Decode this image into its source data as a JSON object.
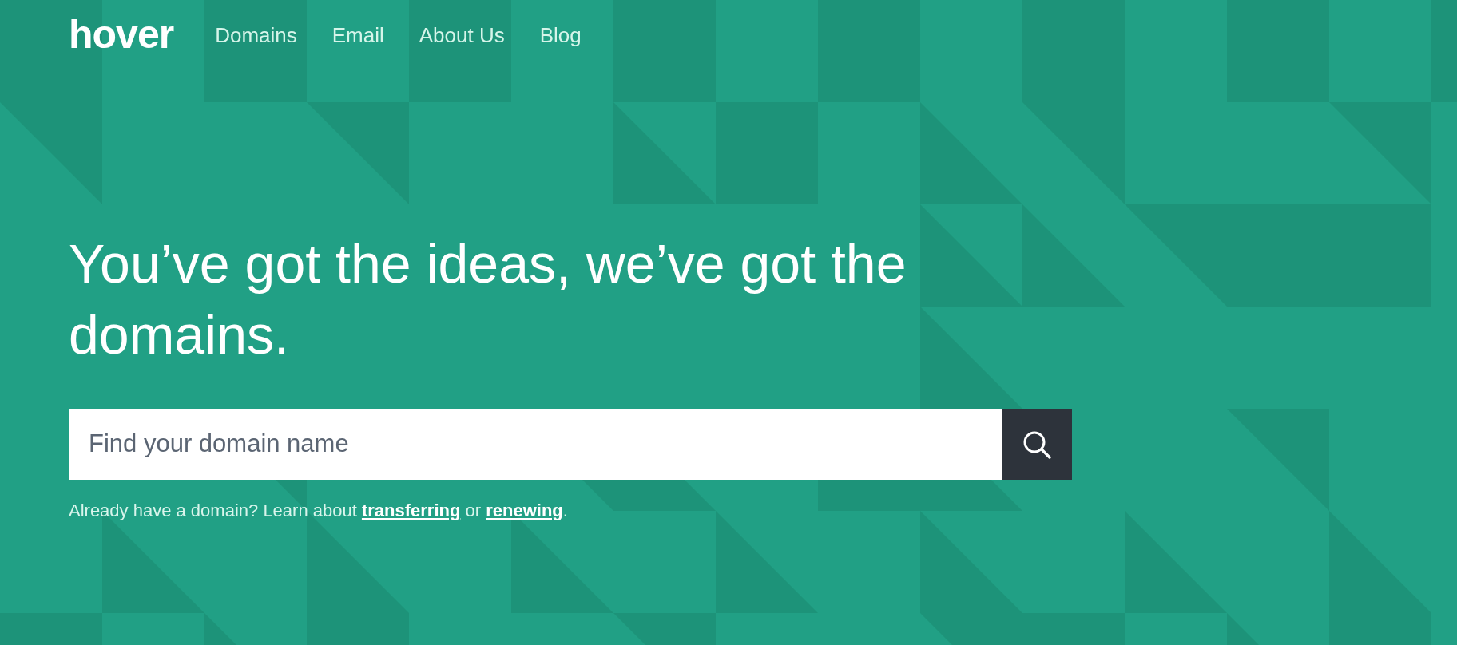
{
  "logo": "hover",
  "nav": [
    "Domains",
    "Email",
    "About Us",
    "Blog"
  ],
  "headline": "You’ve got the ideas, we’ve got the domains.",
  "search": {
    "placeholder": "Find your domain name"
  },
  "hint": {
    "lead": "Already have a domain? Learn about ",
    "links": [
      "transferring",
      "renewing"
    ],
    "joiner": " or ",
    "end": "."
  }
}
